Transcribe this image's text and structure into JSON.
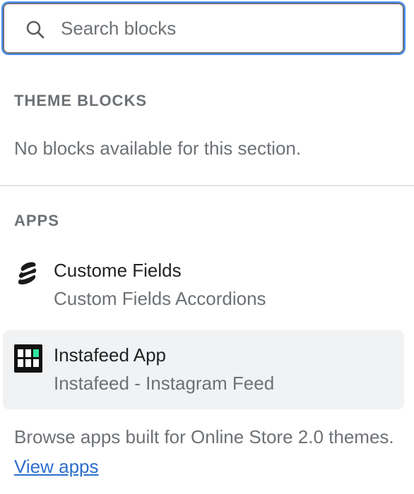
{
  "search": {
    "placeholder": "Search blocks",
    "icon": "search-icon"
  },
  "theme_blocks": {
    "heading": "THEME BLOCKS",
    "empty_message": "No blocks available for this section."
  },
  "apps": {
    "heading": "APPS",
    "items": [
      {
        "title": "Custome Fields",
        "subtitle": "Custom Fields Accordions",
        "icon": "stacked-discs-icon",
        "selected": false
      },
      {
        "title": "Instafeed App",
        "subtitle": "Instafeed - Instagram Feed",
        "icon": "grid-icon",
        "selected": true
      }
    ]
  },
  "footer": {
    "text_prefix": "Browse apps built for Online Store 2.0",
    "text_middle": "themes. ",
    "link_label": "View apps"
  },
  "colors": {
    "focus_ring": "#458fff",
    "subdued_text": "#6d7175",
    "link": "#2c6ecb",
    "selected_bg": "#f1f2f3",
    "instafeed_accent": "#2ee6a0"
  }
}
